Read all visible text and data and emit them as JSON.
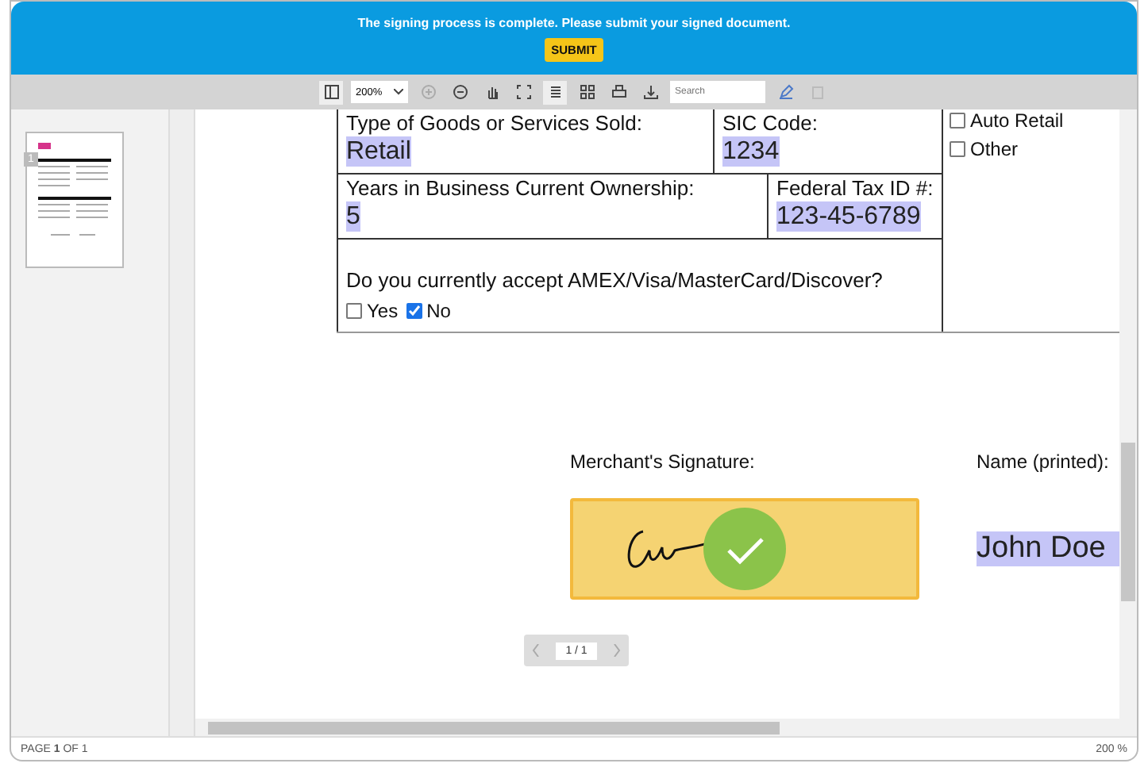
{
  "banner": {
    "message": "The signing process is complete. Please submit your signed document.",
    "button": "SUBMIT"
  },
  "toolbar": {
    "zoom": "200%",
    "search_placeholder": "Search"
  },
  "thumbnails": [
    {
      "page": "1",
      "selected": true
    }
  ],
  "form": {
    "rows": [
      {
        "cells": [
          {
            "label": "Type of Goods or Services Sold:",
            "value": "Retail"
          },
          {
            "label": "SIC Code:",
            "value": "1234"
          }
        ]
      },
      {
        "cells": [
          {
            "label": "Years in Business Current Ownership:",
            "value": "5"
          },
          {
            "label": "Federal Tax ID #:",
            "value": "123-45-6789"
          }
        ]
      }
    ],
    "question": "Do you currently accept AMEX/Visa/MasterCard/Discover?",
    "answers": [
      {
        "label": "Yes",
        "checked": false
      },
      {
        "label": "No",
        "checked": true
      }
    ],
    "side_options": [
      {
        "label": "Auto Retail",
        "checked": false
      },
      {
        "label": "Other",
        "checked": false
      }
    ]
  },
  "signature": {
    "label": "Merchant's Signature:",
    "signed": true,
    "name_label": "Name (printed):",
    "name": "John Doe"
  },
  "pager": "1 / 1",
  "status_bar": {
    "page": "PAGE **1** OF 1",
    "zoom": "200 %"
  }
}
